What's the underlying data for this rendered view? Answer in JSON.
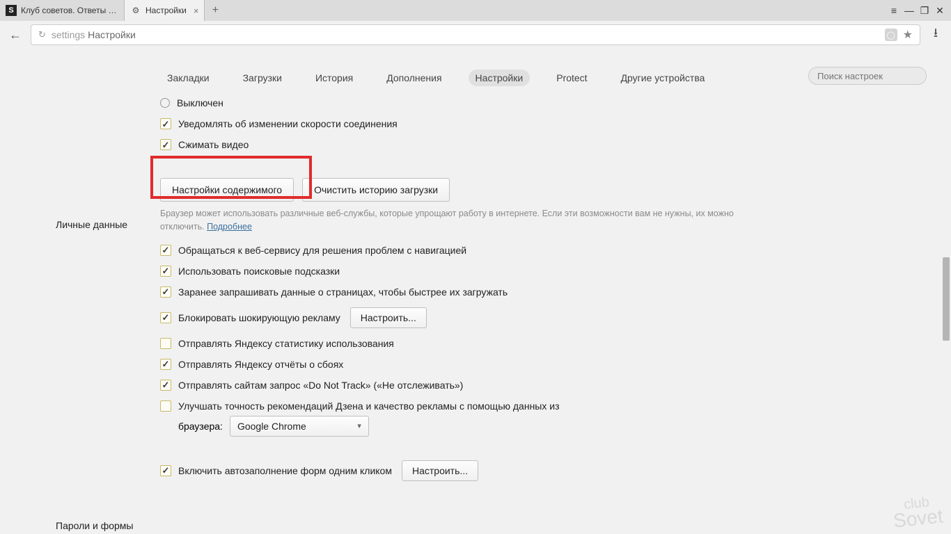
{
  "browser": {
    "tabs": [
      {
        "title": "Клуб советов. Ответы на вс",
        "favicon": "S"
      },
      {
        "title": "Настройки",
        "favicon": "gear"
      }
    ],
    "address_prefix": "settings",
    "address_text": "Настройки",
    "reload_glyph": "↻"
  },
  "topnav": {
    "items": [
      "Закладки",
      "Загрузки",
      "История",
      "Дополнения",
      "Настройки",
      "Protect",
      "Другие устройства"
    ],
    "active_index": 4
  },
  "search": {
    "placeholder": "Поиск настроек"
  },
  "sections": {
    "turbo": {
      "off_label": "Выключен",
      "notify_label": "Уведомлять об изменении скорости соединения",
      "compress_label": "Сжимать видео"
    },
    "personal": {
      "heading": "Личные данные",
      "content_settings_btn": "Настройки содержимого",
      "clear_history_btn": "Очистить историю загрузки",
      "hint_text": "Браузер может использовать различные веб-службы, которые упрощают работу в интернете. Если эти возможности вам не нужны, их можно отключить. ",
      "hint_link": "Подробнее",
      "opts": {
        "nav_service": "Обращаться к веб-сервису для решения проблем с навигацией",
        "suggestions": "Использовать поисковые подсказки",
        "prefetch": "Заранее запрашивать данные о страницах, чтобы быстрее их загружать",
        "block_ads": "Блокировать шокирующую рекламу",
        "configure_btn": "Настроить...",
        "send_stats": "Отправлять Яндексу статистику использования",
        "send_crash": "Отправлять Яндексу отчёты о сбоях",
        "dnt": "Отправлять сайтам запрос «Do Not Track» («Не отслеживать»)",
        "zen": "Улучшать точность рекомендаций Дзена и качество рекламы с помощью данных из",
        "browser_label": "браузера:",
        "browser_select": "Google Chrome"
      }
    },
    "passwords": {
      "heading": "Пароли и формы",
      "autofill": "Включить автозаполнение форм одним кликом",
      "autofill_btn": "Настроить..."
    }
  },
  "window_controls": {
    "menu": "≡",
    "min": "—",
    "max": "❐",
    "close": "✕"
  },
  "watermark": {
    "l1": "club",
    "l2": "Sovet"
  }
}
